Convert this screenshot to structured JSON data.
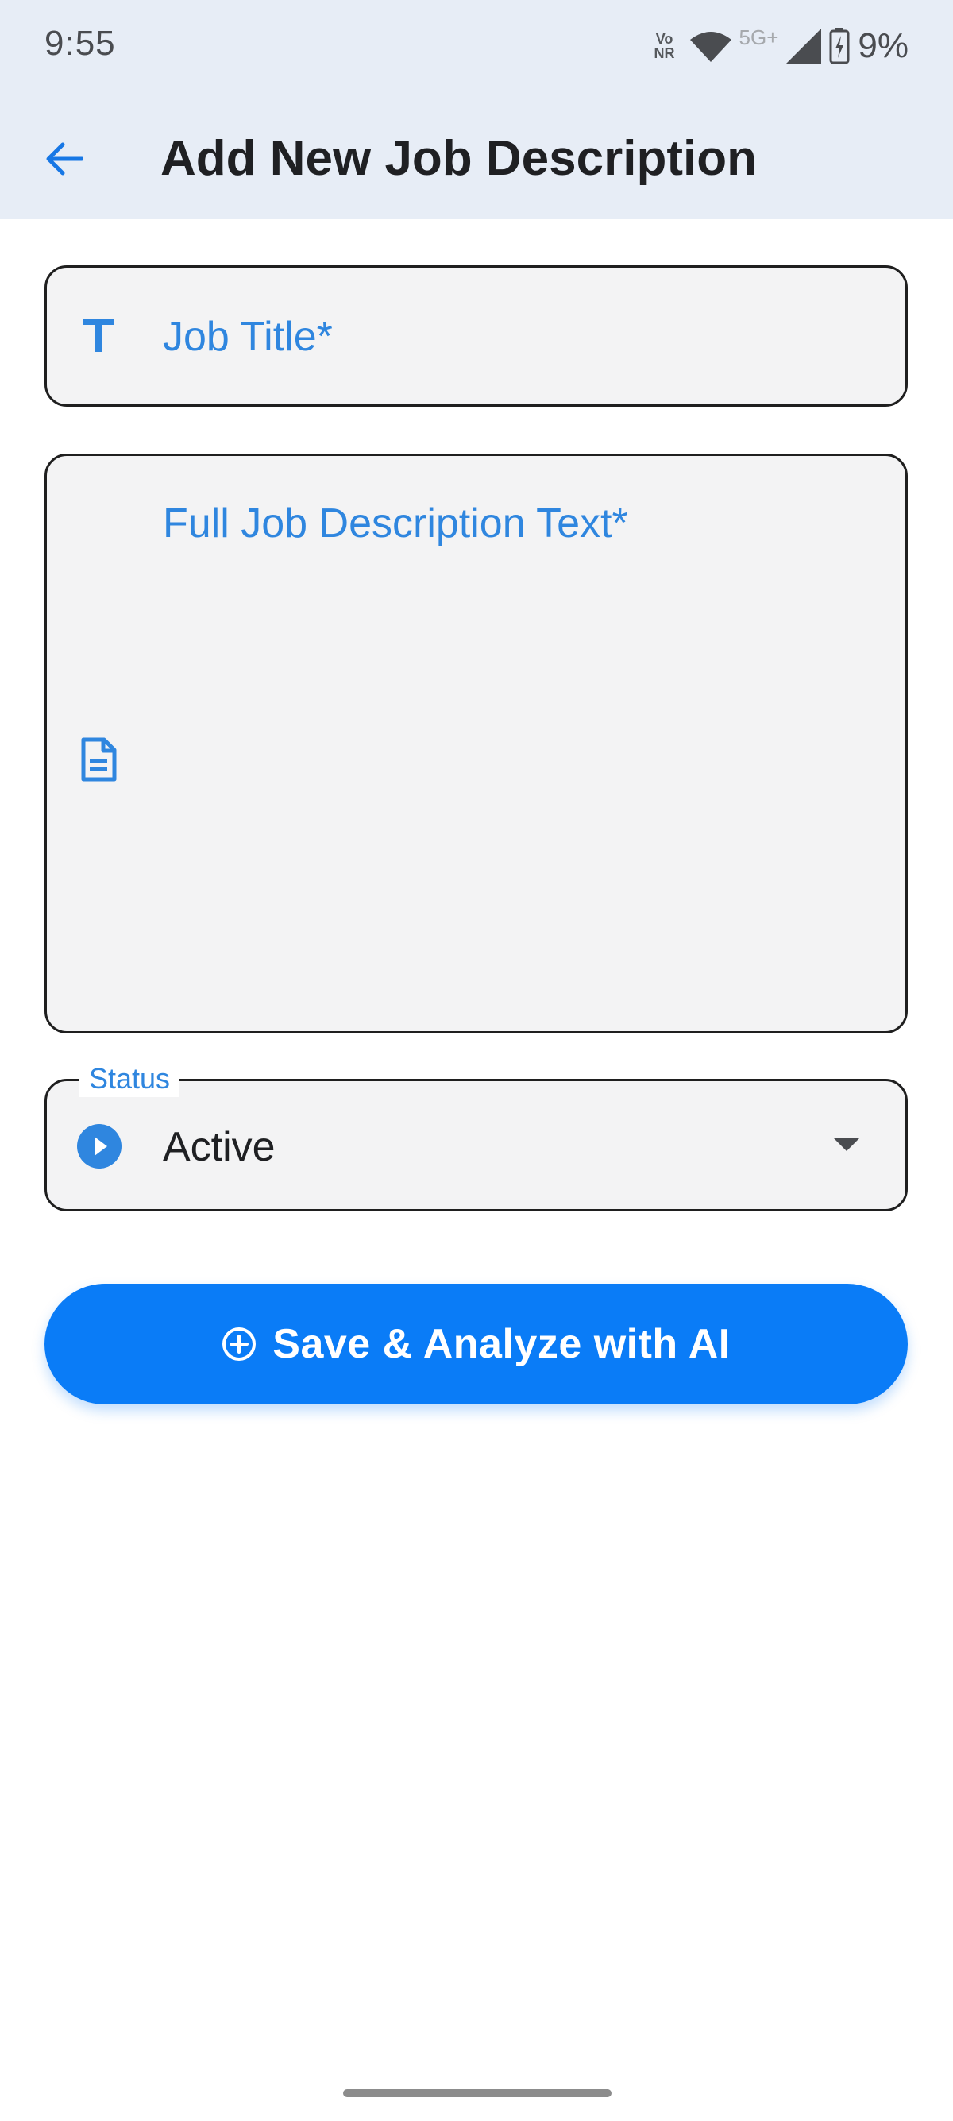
{
  "status_bar": {
    "time": "9:55",
    "network_label_top": "Vo",
    "network_label_bottom": "NR",
    "network_type": "5G+",
    "battery_percent": "9%",
    "icons": [
      "vonr-icon",
      "wifi-icon",
      "cell-signal-icon",
      "battery-charging-icon"
    ]
  },
  "app_bar": {
    "back_icon": "arrow-left-icon",
    "title": "Add New Job Description"
  },
  "form": {
    "job_title": {
      "icon": "text-format-icon",
      "label": "Job Title*",
      "value": ""
    },
    "description": {
      "icon": "document-icon",
      "label": "Full Job Description Text*",
      "value": ""
    },
    "status": {
      "icon": "play-circle-icon",
      "label": "Status",
      "value": "Active",
      "dropdown_icon": "dropdown-arrow-icon"
    }
  },
  "primary_action": {
    "icon": "add-circle-outline-icon",
    "label": "Save & Analyze with AI"
  },
  "colors": {
    "accent": "#0a7cf7",
    "label_blue": "#2f86df",
    "app_bar_bg": "#e7edf6",
    "field_bg": "#f3f3f4"
  }
}
